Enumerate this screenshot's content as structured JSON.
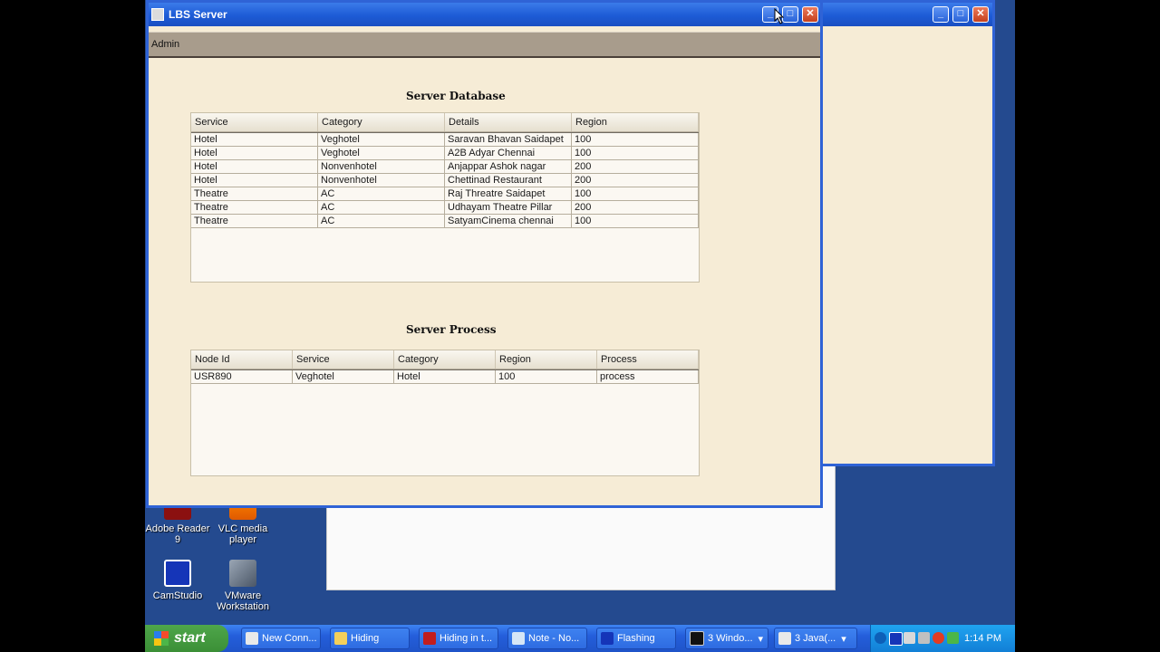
{
  "main_window": {
    "title": "LBS Server",
    "menu_label": "Admin"
  },
  "server_database": {
    "title": "Server Database",
    "columns": [
      "Service",
      "Category",
      "Details",
      "Region"
    ],
    "rows": [
      [
        "Hotel",
        "Veghotel",
        "Saravan Bhavan Saidapet",
        "100"
      ],
      [
        "Hotel",
        "Veghotel",
        "A2B Adyar Chennai",
        "100"
      ],
      [
        "Hotel",
        "Nonvenhotel",
        "Anjappar Ashok nagar",
        "200"
      ],
      [
        "Hotel",
        "Nonvenhotel",
        "Chettinad Restaurant",
        "200"
      ],
      [
        "Theatre",
        "AC",
        "Raj Threatre Saidapet",
        "100"
      ],
      [
        "Theatre",
        "AC",
        "Udhayam Theatre Pillar",
        "200"
      ],
      [
        "Theatre",
        "AC",
        "SatyamCinema chennai",
        "100"
      ]
    ]
  },
  "server_process": {
    "title": "Server Process",
    "columns": [
      "Node Id",
      "Service",
      "Category",
      "Region",
      "Process"
    ],
    "rows": [
      [
        "USR890",
        "Veghotel",
        "Hotel",
        "100",
        "process"
      ]
    ]
  },
  "desktop_icons": [
    {
      "label": "Adobe Reader 9",
      "icon": "pdf-icon"
    },
    {
      "label": "VLC media player",
      "icon": "vlc-cone-icon"
    },
    {
      "label": "CamStudio",
      "icon": "camstudio-icon"
    },
    {
      "label": "VMware Workstation",
      "icon": "vmware-icon"
    }
  ],
  "taskbar": {
    "start_label": "start",
    "tasks": [
      "New Conn...",
      "Hiding",
      "Hiding in t...",
      "Note - No...",
      "Flashing",
      "3 Windo...",
      "3 Java(..."
    ],
    "clock": "1:14 PM"
  },
  "colors": {
    "desktop": "#244a8f",
    "title_bar": "#1d5bd6",
    "window_bg": "#f6ecd6",
    "menu_bar": "#a89c8c"
  }
}
